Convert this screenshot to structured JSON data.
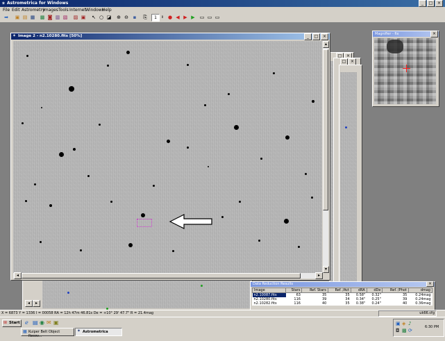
{
  "app": {
    "title": "Astrometrica for Windows"
  },
  "menu": [
    "File",
    "Edit",
    "Astrometry",
    "Images",
    "Tools",
    "Internet",
    "Windows",
    "Help"
  ],
  "toolbar": {
    "frame_value": "1"
  },
  "image_window": {
    "title": "Image 2 - n2.10280.fits [50%]"
  },
  "magnifier": {
    "title": "Magnifier - fix"
  },
  "results": {
    "title": "Data Reduction Results",
    "headers": [
      "Image",
      "Stars",
      "Ref. Stars",
      "Ref. /Act",
      "dRA",
      "dDe",
      "Ref. /Phot",
      "dmag"
    ],
    "rows": [
      [
        "n2.10087.fits",
        "63",
        "35",
        "35",
        "0.58\"",
        "0.32\"",
        "35",
        "0.24mag"
      ],
      [
        "n2.10280.fits",
        "116",
        "39",
        "34",
        "0.34\"",
        "0.25\"",
        "39",
        "0.24mag"
      ],
      [
        "n2.10282.fits",
        "116",
        "40",
        "35",
        "0.38\"",
        "0.24\"",
        "40",
        "0.36mag"
      ]
    ]
  },
  "status": {
    "coords": "X = 6873  Y = 1336  I = 00058  RA = 12h 47m 46.81s  De = +10° 29' 47.7\"  R = 21.4mag",
    "config": "uk66.cfg"
  },
  "taskbar": {
    "start": "Start",
    "tasks": [
      "Kuiper Belt Object Recov...",
      "Astrometrica"
    ],
    "clock": "6:30 PM"
  },
  "colors": {
    "title_active": "#0a246a",
    "title_inactive": "#7a96df",
    "chrome": "#d4d0c8",
    "arrow": "#ffffff",
    "marker": "#cc33cc"
  }
}
